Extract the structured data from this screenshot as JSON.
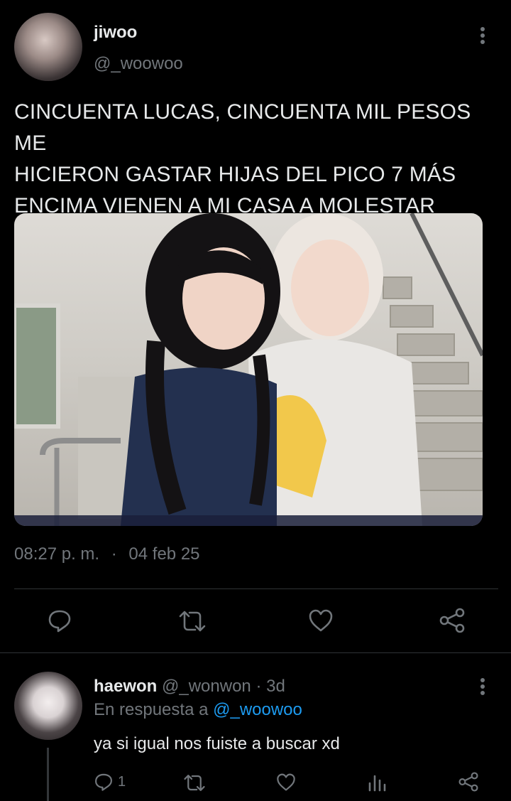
{
  "main_tweet": {
    "author_name": "jiwoo",
    "author_handle": "@_woowoo",
    "text_lines": [
      "CINCUENTA LUCAS, CINCUENTA MIL PESOS ME",
      "HICIERON GASTAR HIJAS DEL PICO 7 MÁS",
      "ENCIMA VIENEN A MI CASA A MOLESTAR"
    ],
    "time": "08:27 p. m.",
    "separator": "·",
    "date": "04 feb 25",
    "icons": [
      "reply-icon",
      "retweet-icon",
      "like-icon",
      "share-icon"
    ]
  },
  "reply": {
    "author_name": "haewon",
    "author_handle": "@_wonwon",
    "separator": "·",
    "age": "3d",
    "in_reply_prefix": "En respuesta a",
    "in_reply_handle": "@_woowoo",
    "text": "ya si igual nos fuiste a buscar xd",
    "reply_count": "1",
    "icons": [
      "reply-icon",
      "retweet-icon",
      "like-icon",
      "views-icon",
      "share-icon"
    ]
  },
  "colors": {
    "background": "#000000",
    "text": "#e7e9ea",
    "muted": "#71767b",
    "link": "#1d9bf0",
    "divider": "#2f3336"
  }
}
